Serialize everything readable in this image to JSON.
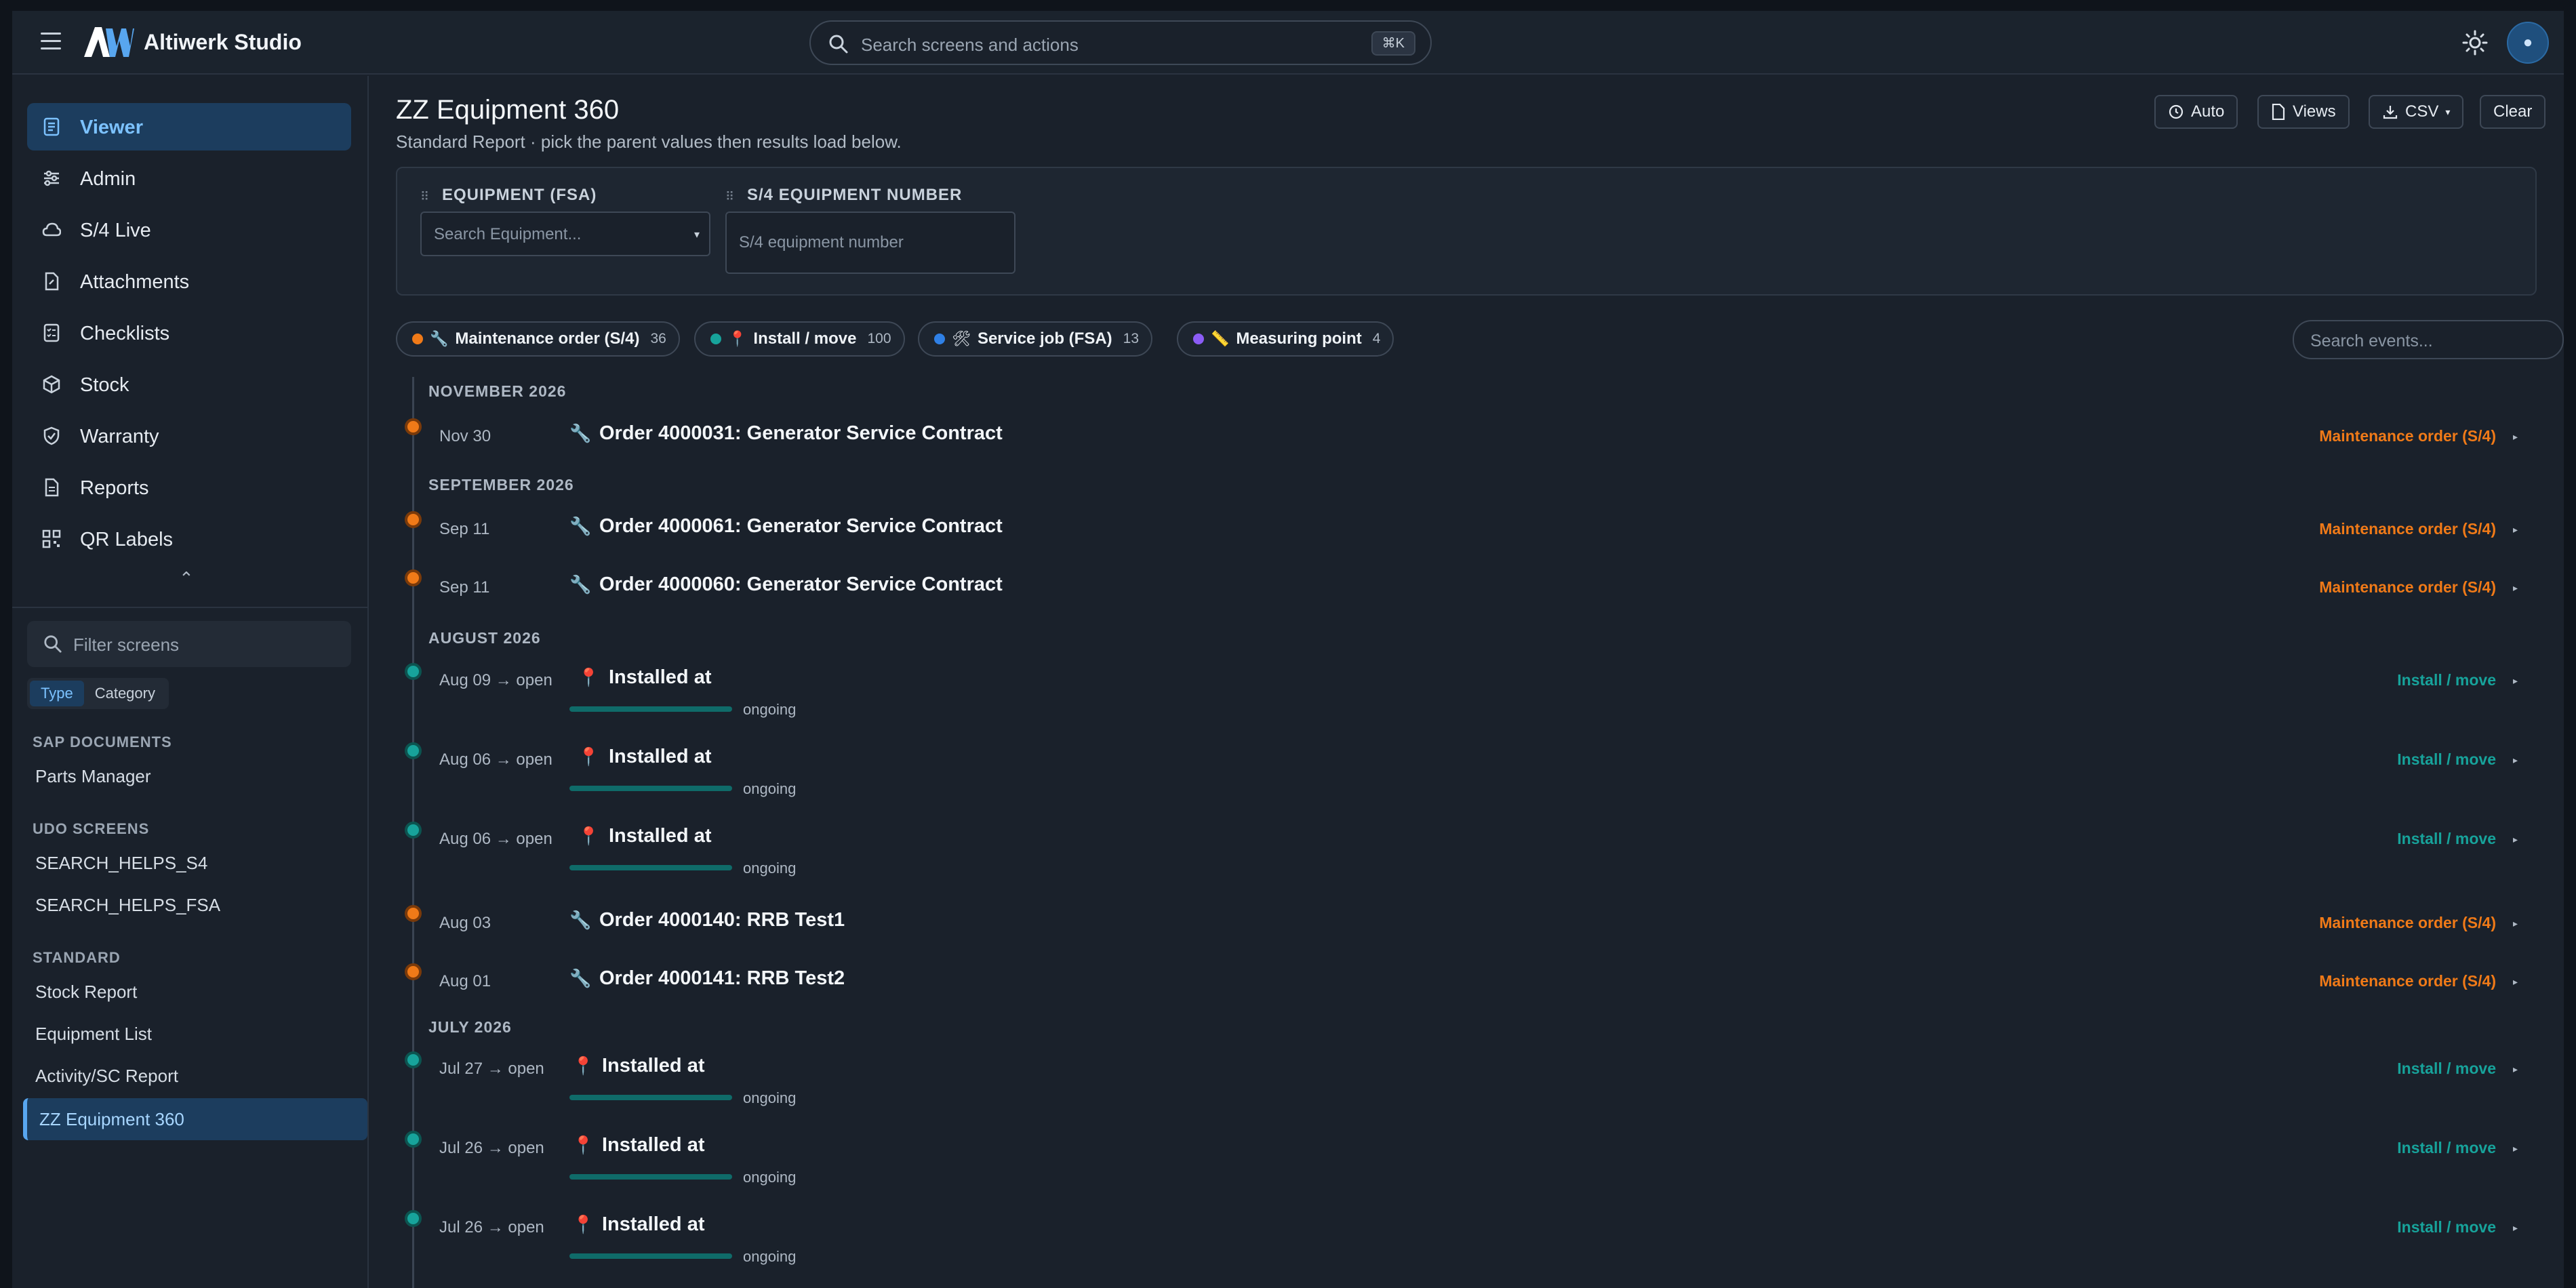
{
  "app": {
    "title": "Altiwerk Studio",
    "search_placeholder": "Search screens and actions",
    "search_shortcut": "⌘K",
    "accent": "#58a6ef"
  },
  "sidebar": {
    "nav": [
      {
        "label": "Viewer",
        "icon": "document-icon",
        "active": true
      },
      {
        "label": "Admin",
        "icon": "sliders-icon"
      },
      {
        "label": "S/4 Live",
        "icon": "cloud-icon"
      },
      {
        "label": "Attachments",
        "icon": "paperclip-file-icon"
      },
      {
        "label": "Checklists",
        "icon": "checklist-icon"
      },
      {
        "label": "Stock",
        "icon": "box-icon"
      },
      {
        "label": "Warranty",
        "icon": "shield-icon"
      },
      {
        "label": "Reports",
        "icon": "report-icon"
      },
      {
        "label": "QR Labels",
        "icon": "qr-code-icon"
      }
    ],
    "filter_placeholder": "Filter screens",
    "group_toggle": {
      "type": "Type",
      "category": "Category"
    },
    "sections": [
      {
        "heading": "SAP DOCUMENTS",
        "items": [
          "Parts Manager"
        ]
      },
      {
        "heading": "UDO SCREENS",
        "items": [
          "SEARCH_HELPS_S4",
          "SEARCH_HELPS_FSA"
        ]
      },
      {
        "heading": "STANDARD",
        "items": [
          "Stock Report",
          "Equipment List",
          "Activity/SC Report",
          "ZZ Equipment 360"
        ]
      }
    ]
  },
  "page": {
    "title": "ZZ Equipment 360",
    "subtitle": "Standard Report · pick the parent values then results load below.",
    "toolbar": {
      "auto": "Auto",
      "views": "Views",
      "csv": "CSV",
      "clear": "Clear"
    },
    "filters": {
      "equipment_label": "EQUIPMENT (FSA)",
      "equipment_placeholder": "Search Equipment...",
      "s4_label": "S/4 EQUIPMENT NUMBER",
      "s4_placeholder": "S/4 equipment number"
    },
    "chips": [
      {
        "name": "Maintenance order (S/4)",
        "count": "36",
        "color": "#f07a18",
        "icon": "🔧"
      },
      {
        "name": "Install / move",
        "count": "100",
        "color": "#17a39b",
        "icon": "📍"
      },
      {
        "name": "Service job (FSA)",
        "count": "13",
        "color": "#2f80e6",
        "icon": "🛠"
      },
      {
        "name": "Measuring point",
        "count": "4",
        "color": "#8b5cf6",
        "icon": "📏"
      }
    ],
    "events_search_placeholder": "Search events..."
  },
  "timeline": {
    "months": [
      "NOVEMBER 2026",
      "SEPTEMBER 2026",
      "AUGUST 2026",
      "JULY 2026"
    ],
    "events": [
      {
        "date": "Nov 30",
        "icon": "🔧",
        "title": "Order 4000031: Generator Service Contract",
        "type": "Maintenance order (S/4)",
        "kind": "order"
      },
      {
        "date": "Sep 11",
        "icon": "🔧",
        "title": "Order 4000061: Generator Service Contract",
        "type": "Maintenance order (S/4)",
        "kind": "order"
      },
      {
        "date": "Sep 11",
        "icon": "🔧",
        "title": "Order 4000060: Generator Service Contract",
        "type": "Maintenance order (S/4)",
        "kind": "order"
      },
      {
        "date": "Aug 09 → open",
        "icon": "📍",
        "title": "Installed at",
        "type": "Install / move",
        "kind": "install",
        "status": "ongoing"
      },
      {
        "date": "Aug 06 → open",
        "icon": "📍",
        "title": "Installed at",
        "type": "Install / move",
        "kind": "install",
        "status": "ongoing"
      },
      {
        "date": "Aug 06 → open",
        "icon": "📍",
        "title": "Installed at",
        "type": "Install / move",
        "kind": "install",
        "status": "ongoing"
      },
      {
        "date": "Aug 03",
        "icon": "🔧",
        "title": "Order 4000140: RRB Test1",
        "type": "Maintenance order (S/4)",
        "kind": "order"
      },
      {
        "date": "Aug 01",
        "icon": "🔧",
        "title": "Order 4000141: RRB Test2",
        "type": "Maintenance order (S/4)",
        "kind": "order"
      },
      {
        "date": "Jul 27 → open",
        "icon": "📍",
        "title": "Installed at",
        "type": "Install / move",
        "kind": "install",
        "status": "ongoing"
      },
      {
        "date": "Jul 26 → open",
        "icon": "📍",
        "title": "Installed at",
        "type": "Install / move",
        "kind": "install",
        "status": "ongoing"
      },
      {
        "date": "Jul 26 → open",
        "icon": "📍",
        "title": "Installed at",
        "type": "Install / move",
        "kind": "install",
        "status": "ongoing"
      }
    ],
    "colors": {
      "order": "#f07a18",
      "install": "#17a39b"
    }
  }
}
